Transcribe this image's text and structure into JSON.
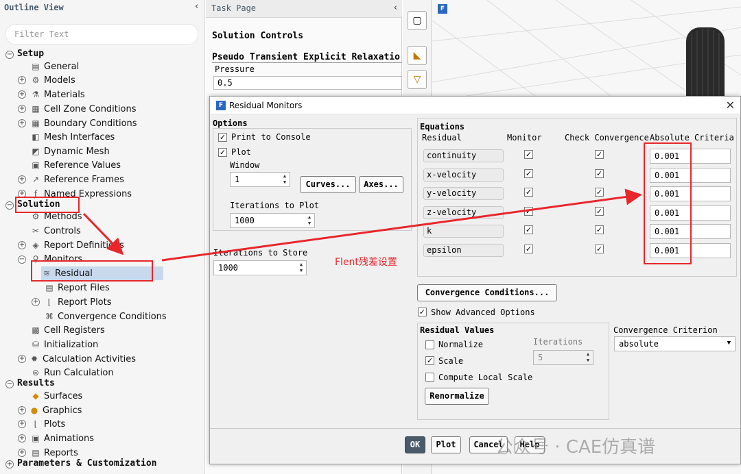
{
  "outline": {
    "title": "Outline View",
    "collapse_glyph": "‹",
    "filter_placeholder": "Filter Text",
    "setup": "Setup",
    "setup_items": [
      "General",
      "Models",
      "Materials",
      "Cell Zone Conditions",
      "Boundary Conditions",
      "Mesh Interfaces",
      "Dynamic Mesh",
      "Reference Values",
      "Reference Frames",
      "Named Expressions"
    ],
    "solution": "Solution",
    "solution_items": [
      "Methods",
      "Controls",
      "Report Definitions",
      "Monitors",
      "Residual",
      "Report Files",
      "Report Plots",
      "Convergence Conditions",
      "Cell Registers",
      "Initialization",
      "Calculation Activities",
      "Run Calculation"
    ],
    "results": "Results",
    "results_items": [
      "Surfaces",
      "Graphics",
      "Plots",
      "Animations",
      "Reports"
    ],
    "parameters": "Parameters & Customization"
  },
  "task": {
    "title": "Task Page",
    "collapse_glyph": "‹",
    "heading": "Solution Controls",
    "subheading": "Pseudo Transient Explicit Relaxatio",
    "pressure_label": "Pressure",
    "pressure_value": "0.5"
  },
  "dialog": {
    "logo": "F",
    "title": "Residual Monitors",
    "close_glyph": "✕",
    "options": {
      "title": "Options",
      "print_to_console": "Print to Console",
      "plot": "Plot",
      "window_label": "Window",
      "window_value": "1",
      "curves_btn": "Curves...",
      "axes_btn": "Axes...",
      "iter_plot_label": "Iterations to Plot",
      "iter_plot_value": "1000",
      "iter_store_label": "Iterations to Store",
      "iter_store_value": "1000"
    },
    "equations": {
      "title": "Equations",
      "col_residual": "Residual",
      "col_monitor": "Monitor",
      "col_check": "Check Convergence",
      "col_abs": "Absolute Criteria",
      "rows": [
        {
          "name": "continuity",
          "criteria": "0.001"
        },
        {
          "name": "x-velocity",
          "criteria": "0.001"
        },
        {
          "name": "y-velocity",
          "criteria": "0.001"
        },
        {
          "name": "z-velocity",
          "criteria": "0.001"
        },
        {
          "name": "k",
          "criteria": "0.001"
        },
        {
          "name": "epsilon",
          "criteria": "0.001"
        }
      ]
    },
    "convergence_conditions_btn": "Convergence Conditions...",
    "show_advanced": "Show Advanced Options",
    "residual_values": {
      "title": "Residual Values",
      "normalize": "Normalize",
      "iterations_label": "Iterations",
      "iterations_value": "5",
      "scale": "Scale",
      "compute_local_scale": "Compute Local Scale",
      "renormalize_btn": "Renormalize"
    },
    "convergence_criterion": {
      "label": "Convergence Criterion",
      "value": "absolute"
    },
    "buttons": {
      "ok": "OK",
      "plot": "Plot",
      "cancel": "Cancel",
      "help": "Help"
    }
  },
  "annotation": "Flent残差设置",
  "watermark": "公众号 · CAE仿真谱",
  "colors": {
    "annotation_red": "#e8262b",
    "selection": "#c8d9ee",
    "fluent_blue": "#2b66c3"
  }
}
